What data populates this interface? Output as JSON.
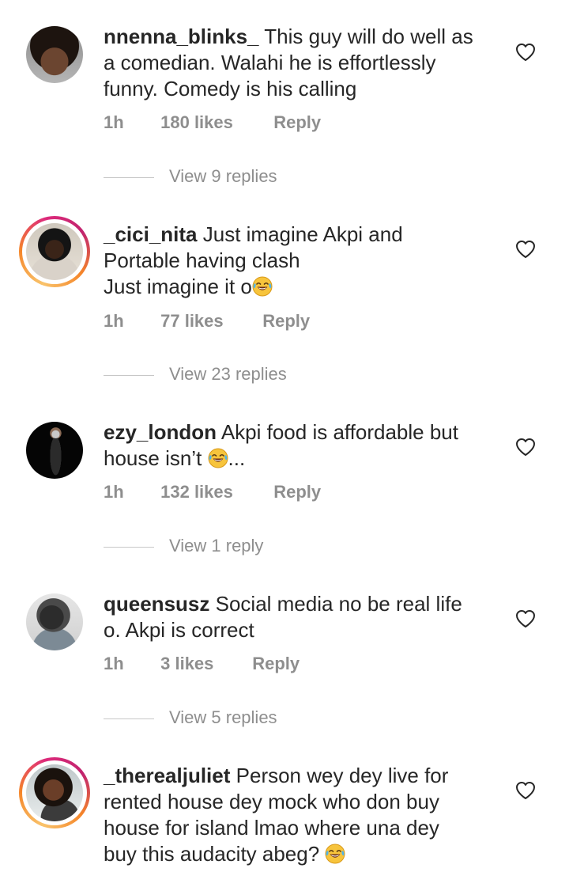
{
  "comments": [
    {
      "username": "nnenna_blinks_",
      "text_lines": [
        "This guy will do well as",
        "a comedian. Walahi he is effortlessly",
        "funny. Comedy is his calling"
      ],
      "line1": "This guy will do well as",
      "line2": "a comedian. Walahi he is effortlessly",
      "line3": "funny. Comedy is his calling",
      "time": "1h",
      "likes": "180 likes",
      "reply": "Reply",
      "view_replies": "View 9 replies"
    },
    {
      "username": "_cici_nita",
      "line1": "Just imagine Akpi and",
      "line2": "Portable having clash",
      "line3": "Just imagine it o",
      "time": "1h",
      "likes": "77 likes",
      "reply": "Reply",
      "view_replies": "View 23 replies"
    },
    {
      "username": "ezy_london",
      "line1": "Akpi food is affordable but",
      "line2": "house isn’t",
      "line2_suffix": "...",
      "time": "1h",
      "likes": "132 likes",
      "reply": "Reply",
      "view_replies": "View 1 reply"
    },
    {
      "username": "queensusz",
      "line1": "Social media no be real life",
      "line2": "o. Akpi is correct",
      "time": "1h",
      "likes": "3 likes",
      "reply": "Reply",
      "view_replies": "View 5 replies"
    },
    {
      "username": "_therealjuliet",
      "line1": "Person wey dey live for",
      "line2": "rented house dey mock who don buy",
      "line3": "house for island lmao where una dey",
      "line4": "buy this audacity abeg?"
    }
  ],
  "icons": {
    "like": "heart-outline-icon",
    "emoji": "face-with-tears-of-joy-icon"
  },
  "colors": {
    "text": "#262626",
    "muted": "#8e8e8e",
    "story_ring": "#dd2a7b"
  }
}
